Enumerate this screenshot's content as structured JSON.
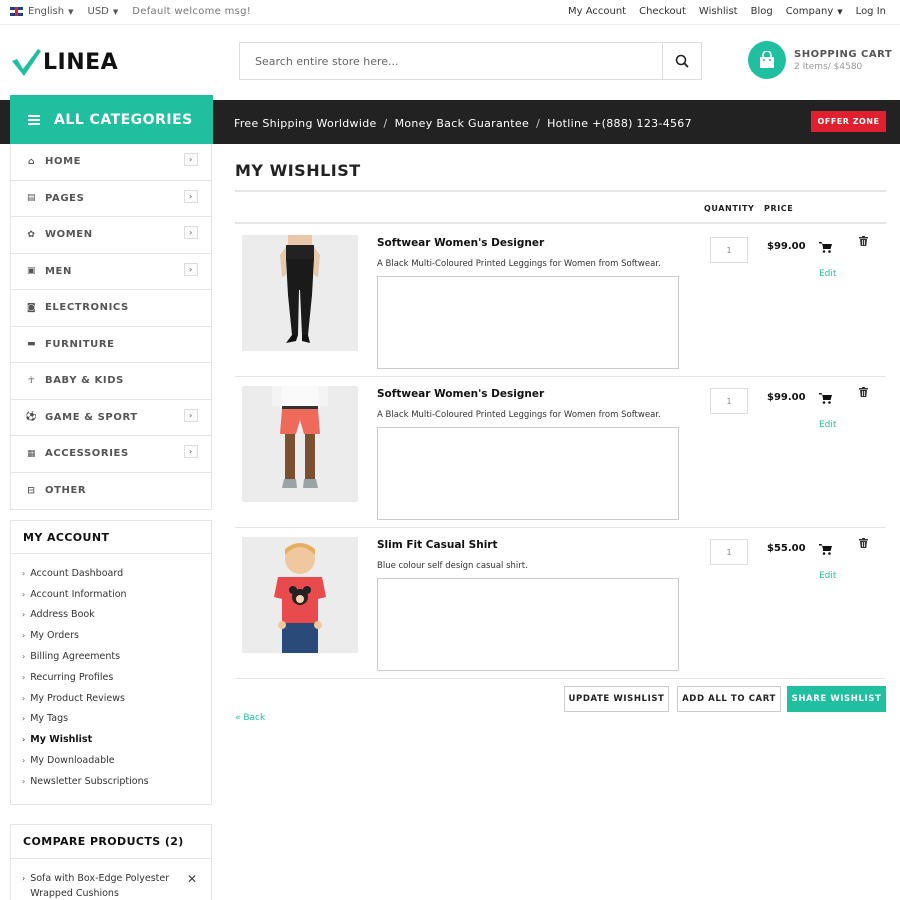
{
  "topbar": {
    "language": "English",
    "currency": "USD",
    "welcome": "Default welcome msg!",
    "links": [
      "My Account",
      "Checkout",
      "Wishlist",
      "Blog",
      "Company",
      "Log In"
    ]
  },
  "header": {
    "logo": "LINEA",
    "search_placeholder": "Search entire store here...",
    "cart_title": "SHOPPING CART",
    "cart_summary": "2 Items/ $4580"
  },
  "nav": {
    "all_categories": "ALL CATEGORIES",
    "promo": [
      "Free Shipping Worldwide",
      "Money Back Guarantee",
      "Hotline +(888) 123-4567"
    ],
    "offer": "OFFER ZONE"
  },
  "categories": [
    {
      "label": "HOME",
      "icon": "home-icon",
      "glyph": "⌂",
      "arrow": true
    },
    {
      "label": "PAGES",
      "icon": "file-icon",
      "glyph": "▤",
      "arrow": true
    },
    {
      "label": "WOMEN",
      "icon": "gift-icon",
      "glyph": "✿",
      "arrow": true
    },
    {
      "label": "MEN",
      "icon": "briefcase-icon",
      "glyph": "▣",
      "arrow": true
    },
    {
      "label": "ELECTRONICS",
      "icon": "camera-icon",
      "glyph": "◙",
      "arrow": false
    },
    {
      "label": "FURNITURE",
      "icon": "bed-icon",
      "glyph": "▬",
      "arrow": false
    },
    {
      "label": "BABY & KIDS",
      "icon": "child-icon",
      "glyph": "☥",
      "arrow": false
    },
    {
      "label": "GAME & SPORT",
      "icon": "football-icon",
      "glyph": "⚽",
      "arrow": true
    },
    {
      "label": "ACCESSORIES",
      "icon": "archive-icon",
      "glyph": "▦",
      "arrow": true
    },
    {
      "label": "OTHER",
      "icon": "basket-icon",
      "glyph": "⊟",
      "arrow": false
    }
  ],
  "account": {
    "title": "MY ACCOUNT",
    "items": [
      "Account Dashboard",
      "Account Information",
      "Address Book",
      "My Orders",
      "Billing Agreements",
      "Recurring Profiles",
      "My Product Reviews",
      "My Tags",
      "My Wishlist",
      "My Downloadable",
      "Newsletter Subscriptions"
    ],
    "active": "My Wishlist"
  },
  "compare": {
    "title": "COMPARE PRODUCTS (2)",
    "items": [
      "Sofa with Box-Edge Polyester Wrapped Cushions"
    ]
  },
  "wishlist": {
    "title": "MY WISHLIST",
    "col_quantity": "QUANTITY",
    "col_price": "PRICE",
    "items": [
      {
        "name": "Softwear Women's Designer",
        "description": "A Black Multi-Coloured Printed Leggings for Women from Softwear.",
        "quantity": "1",
        "price": "$99.00",
        "edit": "Edit"
      },
      {
        "name": "Softwear Women's Designer",
        "description": "A Black Multi-Coloured Printed Leggings for Women from Softwear.",
        "quantity": "1",
        "price": "$99.00",
        "edit": "Edit"
      },
      {
        "name": "Slim Fit Casual Shirt",
        "description": "Blue colour self design casual shirt.",
        "quantity": "1",
        "price": "$55.00",
        "edit": "Edit"
      }
    ],
    "buttons": {
      "update": "UPDATE WISHLIST",
      "add_all": "ADD ALL TO CART",
      "share": "SHARE WISHLIST"
    },
    "back": "« Back"
  },
  "colors": {
    "accent": "#1fbfa0",
    "offer": "#e0202f",
    "navbar": "#222222"
  }
}
